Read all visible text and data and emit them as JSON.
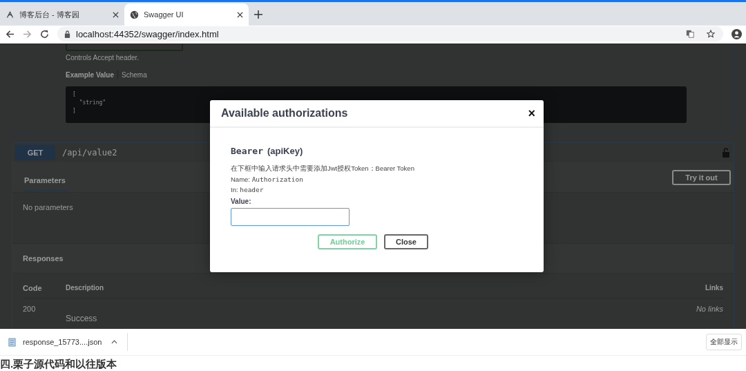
{
  "browser": {
    "tabs": [
      {
        "title": "博客后台 - 博客园",
        "selected": false
      },
      {
        "title": "Swagger UI",
        "selected": true
      }
    ],
    "address": "localhost:44352/swagger/index.html"
  },
  "content_type": {
    "hint": "Controls Accept header."
  },
  "example": {
    "tabs": [
      {
        "label": "Example Value",
        "selected": true
      },
      {
        "label": "Schema",
        "selected": false
      }
    ],
    "code_lines": [
      "[",
      "  \"string\"",
      "]"
    ]
  },
  "operation": {
    "method": "GET",
    "path": "/api/value2",
    "tabs": [
      {
        "label": "Parameters",
        "selected": true
      }
    ],
    "try_button": "Try it out",
    "parameters_text": "No parameters",
    "responses_title": "Responses",
    "columns": [
      "Code",
      "Description",
      "Links"
    ],
    "responses": [
      {
        "code": "200",
        "description": "Success",
        "links": "No links"
      }
    ]
  },
  "modal": {
    "title": "Available authorizations",
    "close": "×",
    "scheme_name": "Bearer",
    "scheme_type": "(apiKey)",
    "description": "在下框中输入请求头中需要添加Jwt授权Token：Bearer Token",
    "name_label": "Name:",
    "name_value": "Authorization",
    "in_label": "In:",
    "in_value": "header",
    "value_label": "Value:",
    "buttons": [
      {
        "label": "Authorize",
        "kind": "primary"
      },
      {
        "label": "Close",
        "kind": "secondary"
      }
    ]
  },
  "download_bar": {
    "file": "response_15773....json",
    "show_all": "全部显示"
  },
  "article_heading": "四.栗子源代码和以往版本"
}
